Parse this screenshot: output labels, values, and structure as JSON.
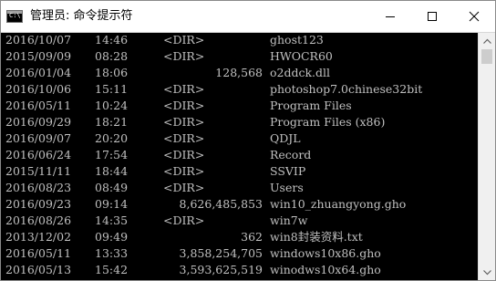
{
  "window": {
    "title": "管理员: 命令提示符",
    "icon": "cmd-icon",
    "controls": [
      "minimize-icon",
      "maximize-icon",
      "close-icon"
    ]
  },
  "console": {
    "rows": [
      {
        "date": "2016/10/07",
        "time": "14:46",
        "dir": "<DIR>",
        "size": "",
        "name": "ghost123"
      },
      {
        "date": "2015/09/09",
        "time": "08:28",
        "dir": "<DIR>",
        "size": "",
        "name": "HWOCR60"
      },
      {
        "date": "2016/01/04",
        "time": "18:06",
        "dir": "",
        "size": "128,568",
        "name": "o2ddck.dll"
      },
      {
        "date": "2016/10/06",
        "time": "15:11",
        "dir": "<DIR>",
        "size": "",
        "name": "photoshop7.0chinese32bit"
      },
      {
        "date": "2016/05/11",
        "time": "10:24",
        "dir": "<DIR>",
        "size": "",
        "name": "Program Files"
      },
      {
        "date": "2016/09/29",
        "time": "18:21",
        "dir": "<DIR>",
        "size": "",
        "name": "Program Files (x86)"
      },
      {
        "date": "2016/09/07",
        "time": "20:20",
        "dir": "<DIR>",
        "size": "",
        "name": "QDJL"
      },
      {
        "date": "2016/06/24",
        "time": "17:54",
        "dir": "<DIR>",
        "size": "",
        "name": "Record"
      },
      {
        "date": "2015/11/11",
        "time": "18:44",
        "dir": "<DIR>",
        "size": "",
        "name": "SSVIP"
      },
      {
        "date": "2016/08/23",
        "time": "08:49",
        "dir": "<DIR>",
        "size": "",
        "name": "Users"
      },
      {
        "date": "2016/09/23",
        "time": "09:14",
        "dir": "",
        "size": "8,626,485,853",
        "name": "win10_zhuangyong.gho"
      },
      {
        "date": "2016/08/26",
        "time": "14:35",
        "dir": "<DIR>",
        "size": "",
        "name": "win7w"
      },
      {
        "date": "2013/12/02",
        "time": "09:49",
        "dir": "",
        "size": "362",
        "name": "win8封装资料.txt"
      },
      {
        "date": "2016/05/11",
        "time": "13:33",
        "dir": "",
        "size": "3,858,254,705",
        "name": "windows10x86.gho"
      },
      {
        "date": "2016/05/13",
        "time": "15:42",
        "dir": "",
        "size": "3,593,625,519",
        "name": "winodws10x64.gho"
      }
    ]
  },
  "colors": {
    "console_bg": "#000000",
    "console_text": "#c0c0c0",
    "titlebar_bg": "#ffffff",
    "scrollbar_bg": "#f0f0f0"
  }
}
